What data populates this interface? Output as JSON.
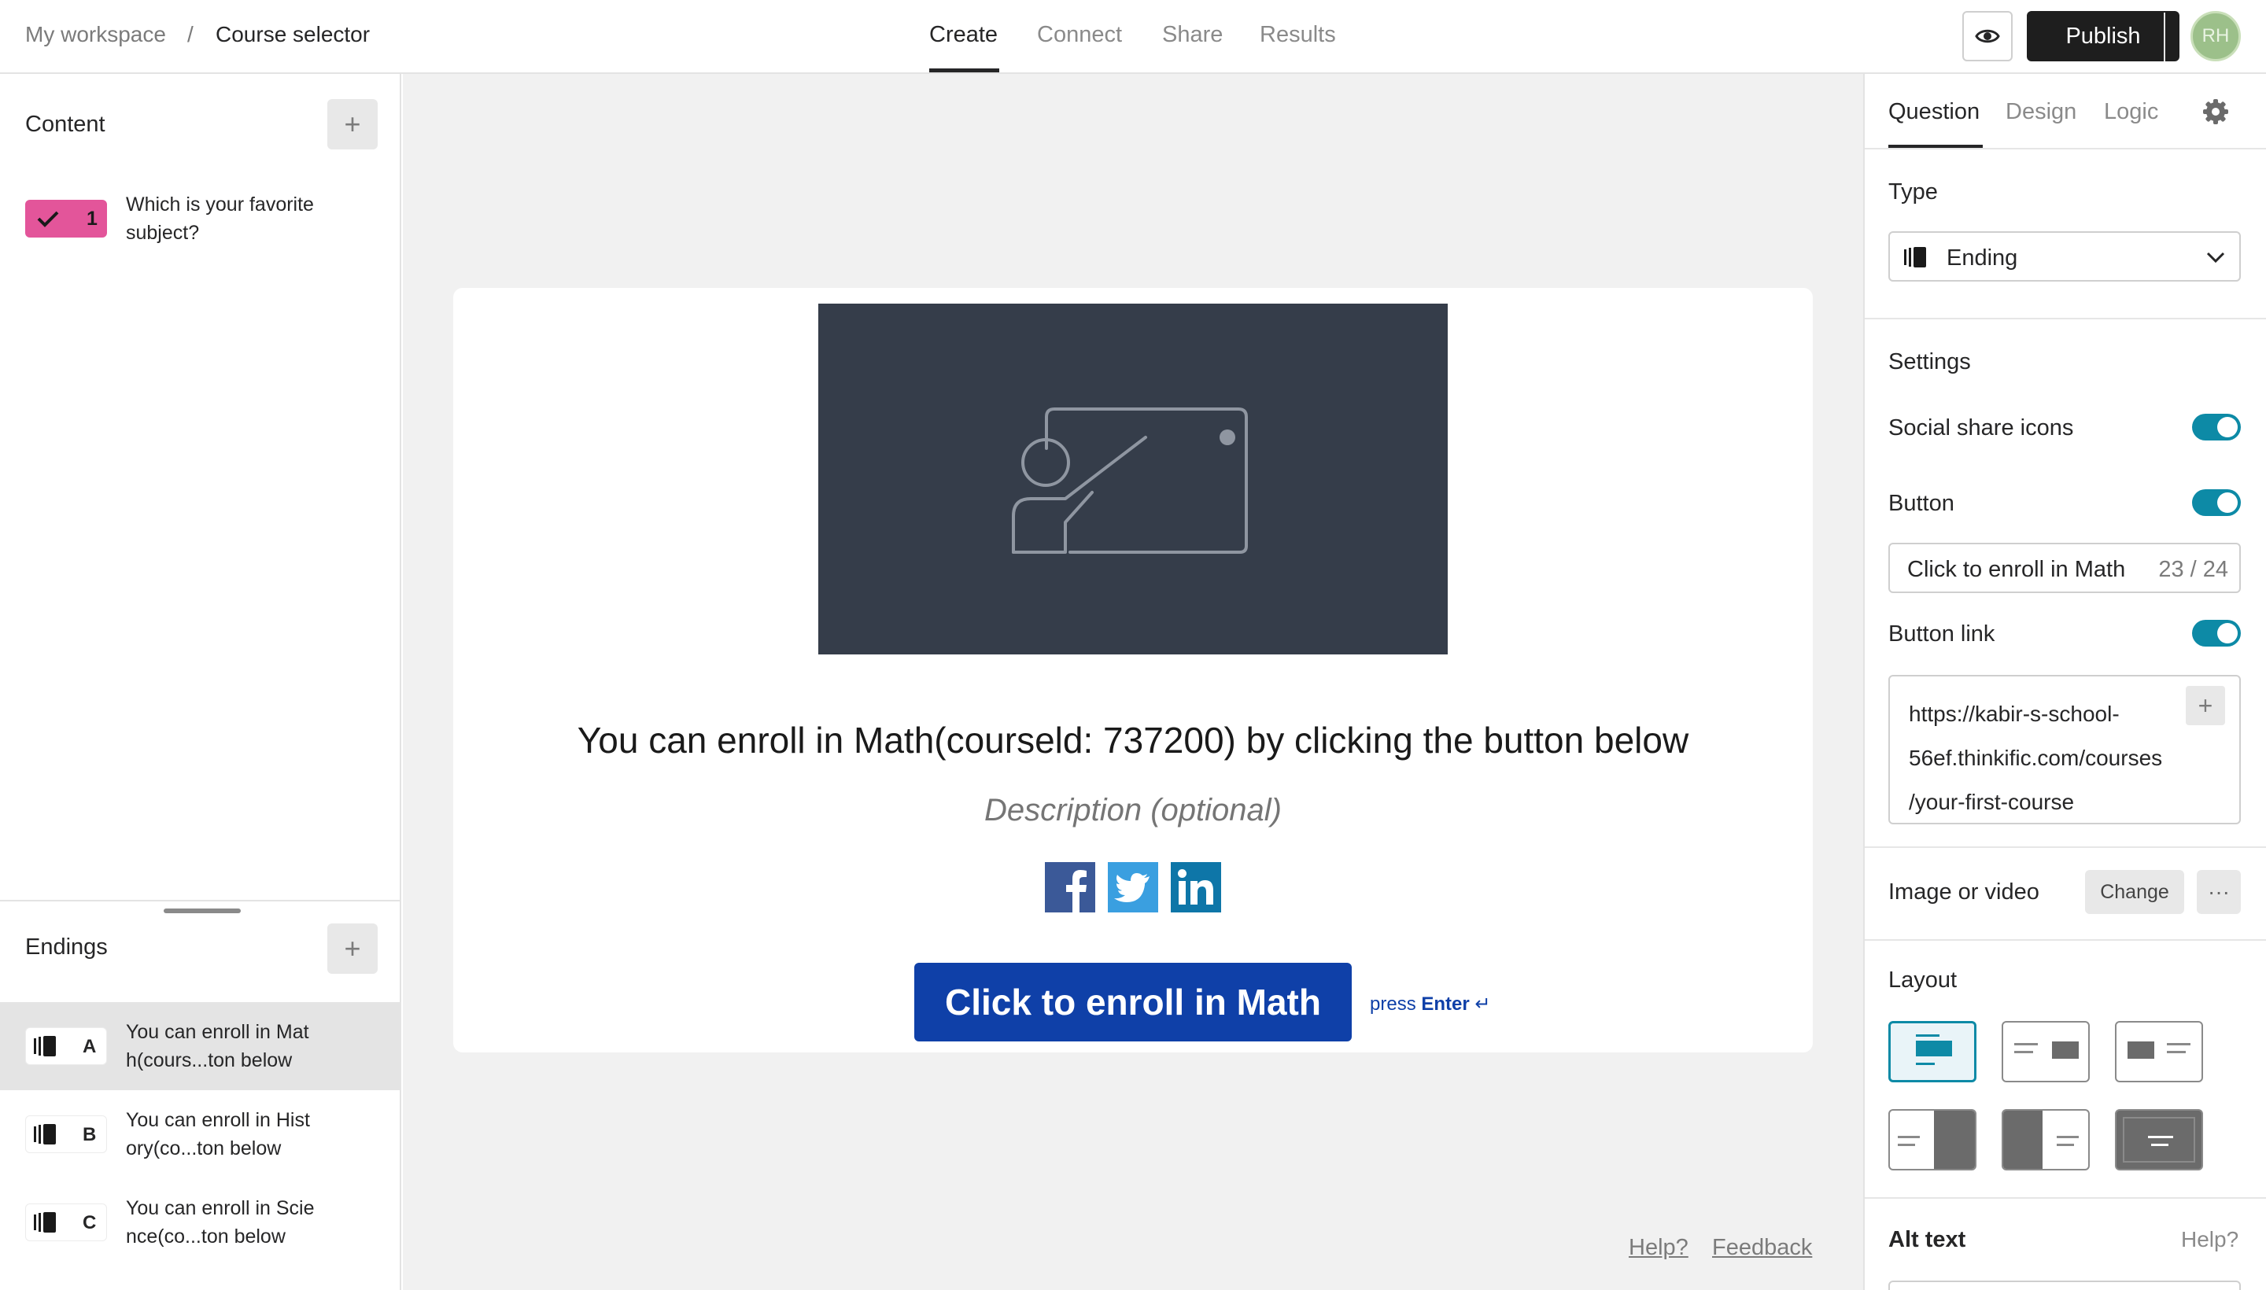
{
  "breadcrumb": {
    "workspace": "My workspace",
    "separator": "/",
    "form": "Course selector"
  },
  "nav_tabs": [
    {
      "label": "Create",
      "active": true
    },
    {
      "label": "Connect",
      "active": false
    },
    {
      "label": "Share",
      "active": false
    },
    {
      "label": "Results",
      "active": false
    }
  ],
  "topbar": {
    "publish_label": "Publish",
    "avatar_initials": "RH",
    "preview_icon": "eye-icon"
  },
  "left_panel": {
    "content_title": "Content",
    "add_label": "+",
    "questions": [
      {
        "number": "1",
        "text": "Which is your favorite subject?",
        "color": "#e3559a",
        "icon": "checkmark-icon"
      }
    ],
    "endings_title": "Endings",
    "endings": [
      {
        "letter": "A",
        "text": "You can enroll in Mat h(cours...ton below",
        "selected": true
      },
      {
        "letter": "B",
        "text": "You can enroll in Hist ory(co...ton below",
        "selected": false
      },
      {
        "letter": "C",
        "text": "You can enroll in Scie nce(co...ton below",
        "selected": false
      }
    ]
  },
  "canvas": {
    "heading": "You can enroll in Math(courseld: 737200) by clicking the button below",
    "description_placeholder": "Description (optional)",
    "social_icons": [
      "facebook-icon",
      "twitter-icon",
      "linkedin-icon"
    ],
    "button_label": "Click to enroll in Math",
    "press_prefix": "press",
    "press_key": "Enter",
    "press_glyph": "↵",
    "help_link": "Help?",
    "feedback_link": "Feedback",
    "image_icon": "teacher-whiteboard-icon"
  },
  "right_panel": {
    "tabs": [
      {
        "label": "Question",
        "active": true
      },
      {
        "label": "Design",
        "active": false
      },
      {
        "label": "Logic",
        "active": false
      }
    ],
    "settings_icon": "gear-icon",
    "type_label": "Type",
    "type_value": "Ending",
    "settings_label": "Settings",
    "social_share_label": "Social share icons",
    "social_share_on": true,
    "button_label": "Button",
    "button_on": true,
    "button_text_value": "Click to enroll in Math",
    "button_text_count": "23 / 24",
    "button_link_label": "Button link",
    "button_link_on": true,
    "button_link_value": "https://kabir-s-school-56ef.thinkific.com/courses/your-first-course",
    "button_link_lines": [
      "https://kabir-s-school-",
      "56ef.thinkific.com/courses",
      "/your-first-course"
    ],
    "image_label": "Image or video",
    "change_label": "Change",
    "more_label": "···",
    "layout_label": "Layout",
    "alt_text_label": "Alt text",
    "alt_help": "Help?"
  },
  "colors": {
    "accent_teal": "#0d8aa6",
    "button_blue": "#0f40a8",
    "question_pink": "#e3559a",
    "hero_bg": "#353d4a",
    "canvas_bg": "#f1f1f1"
  }
}
